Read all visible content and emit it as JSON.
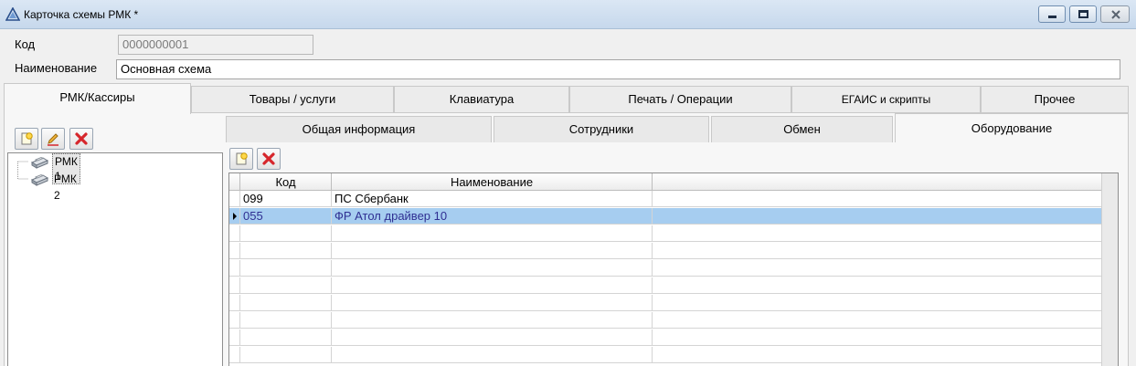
{
  "window": {
    "title": "Карточка схемы РМК *"
  },
  "form": {
    "code_label": "Код",
    "code_value": "0000000001",
    "name_label": "Наименование",
    "name_value": "Основная схема"
  },
  "main_tabs": [
    {
      "label": "РМК/Кассиры",
      "active": true
    },
    {
      "label": "Товары / услуги",
      "active": false
    },
    {
      "label": "Клавиатура",
      "active": false
    },
    {
      "label": "Печать / Операции",
      "active": false
    },
    {
      "label": "ЕГАИС и скрипты",
      "active": false
    },
    {
      "label": "Прочее",
      "active": false
    }
  ],
  "tree": {
    "items": [
      {
        "label": "РМК 1",
        "selected": true,
        "icon": "printer-icon"
      },
      {
        "label": "РМК 2",
        "selected": false,
        "icon": "printer-icon"
      }
    ]
  },
  "sub_tabs": [
    {
      "label": "Общая информация",
      "active": false
    },
    {
      "label": "Сотрудники",
      "active": false
    },
    {
      "label": "Обмен",
      "active": false
    },
    {
      "label": "Оборудование",
      "active": true
    }
  ],
  "grid": {
    "columns": [
      "Код",
      "Наименование"
    ],
    "rows": [
      {
        "code": "099",
        "name": "ПС Сбербанк",
        "selected": false
      },
      {
        "code": "055",
        "name": "ФР Атол драйвер 10",
        "selected": true
      }
    ]
  },
  "icons": {
    "add": "add-document-icon",
    "edit": "edit-pencil-icon",
    "delete": "delete-x-icon"
  },
  "colors": {
    "selection": "#a6cdf0",
    "delete_red": "#d6262b"
  }
}
